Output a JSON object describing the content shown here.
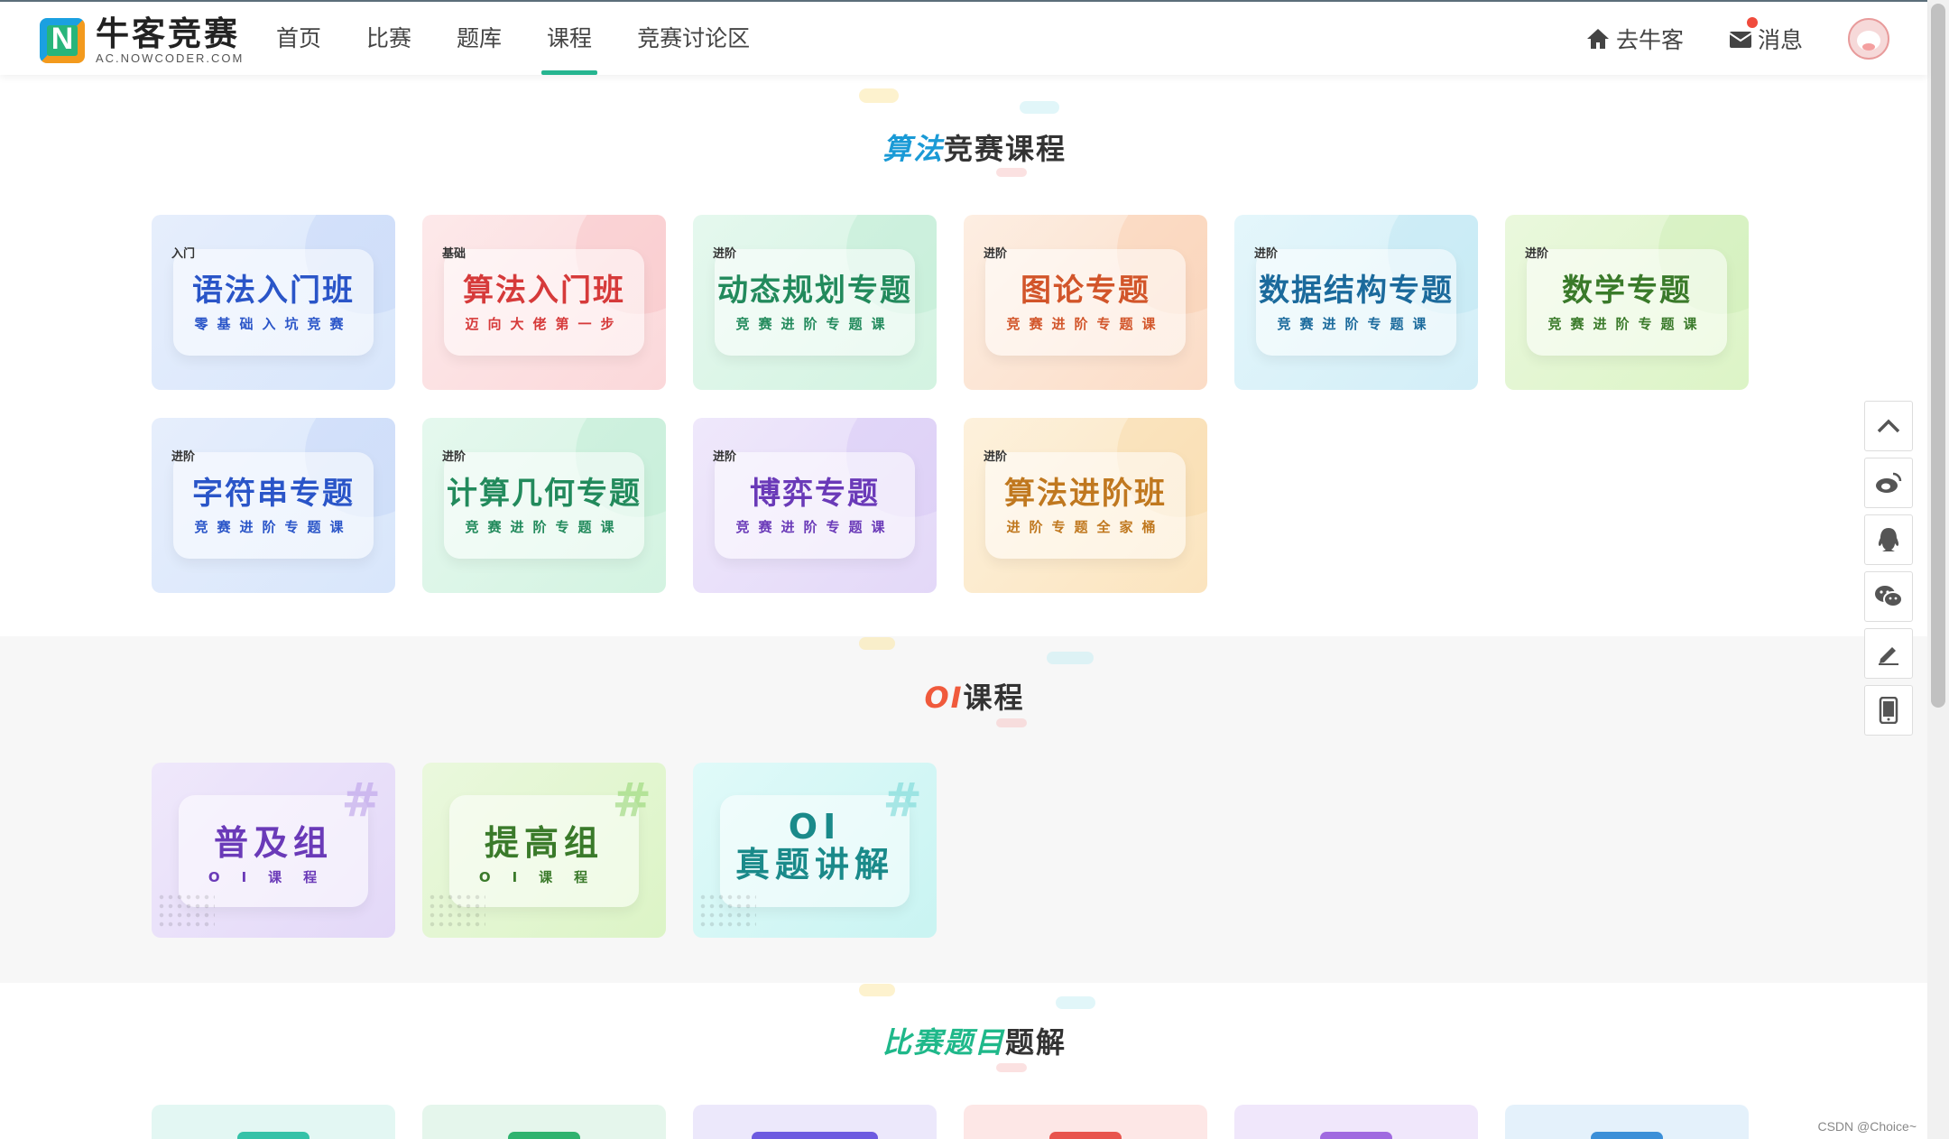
{
  "header": {
    "logo_title": "牛客竞赛",
    "logo_sub": "AC.NOWCODER.COM",
    "logo_letter": "N",
    "nav": [
      "首页",
      "比赛",
      "题库",
      "课程",
      "竞赛讨论区"
    ],
    "active_nav": "课程",
    "go_nowcoder": "去牛客",
    "messages": "消息"
  },
  "sections": {
    "algo_title_hl": "算法",
    "algo_title_rest": "竞赛课程",
    "oi_title_hl": "OI",
    "oi_title_rest": "课程",
    "solutions_title_hl": "比赛题目",
    "solutions_title_rest": "题解"
  },
  "algo_cards": [
    {
      "tag": "入门",
      "title": "语法入门班",
      "sub": "零基础入坑竞赛",
      "theme": "blue"
    },
    {
      "tag": "基础",
      "title": "算法入门班",
      "sub": "迈向大佬第一步",
      "theme": "red"
    },
    {
      "tag": "进阶",
      "title": "动态规划专题",
      "sub": "竞赛进阶专题课",
      "theme": "green"
    },
    {
      "tag": "进阶",
      "title": "图论专题",
      "sub": "竞赛进阶专题课",
      "theme": "orange"
    },
    {
      "tag": "进阶",
      "title": "数据结构专题",
      "sub": "竞赛进阶专题课",
      "theme": "cyan"
    },
    {
      "tag": "进阶",
      "title": "数学专题",
      "sub": "竞赛进阶专题课",
      "theme": "lime"
    },
    {
      "tag": "进阶",
      "title": "字符串专题",
      "sub": "竞赛进阶专题课",
      "theme": "blue"
    },
    {
      "tag": "进阶",
      "title": "计算几何专题",
      "sub": "竞赛进阶专题课",
      "theme": "green"
    },
    {
      "tag": "进阶",
      "title": "博弈专题",
      "sub": "竞赛进阶专题课",
      "theme": "violet"
    },
    {
      "tag": "进阶",
      "title": "算法进阶班",
      "sub": "进阶专题全家桶",
      "theme": "amber"
    }
  ],
  "oi_cards": [
    {
      "title": "普及组",
      "sub": "OI课程",
      "theme": "violet"
    },
    {
      "title": "提高组",
      "sub": "OI课程",
      "theme": "lime"
    },
    {
      "title_line1": "OI",
      "title_line2": "真题讲解",
      "theme": "teal"
    }
  ],
  "side_tools": [
    "chevron-up-icon",
    "weibo-icon",
    "qq-icon",
    "wechat-icon",
    "pencil-icon",
    "mobile-icon"
  ],
  "watermark": "CSDN @Choice~"
}
